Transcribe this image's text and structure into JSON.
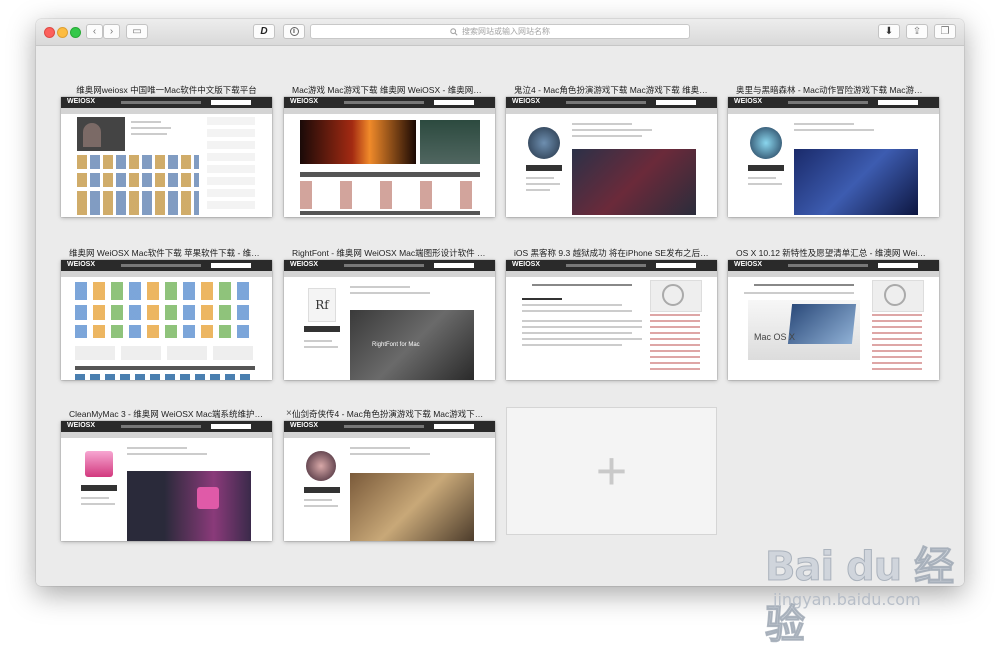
{
  "toolbar": {
    "back_glyph": "‹",
    "forward_glyph": "›",
    "sidebar_glyph": "▭",
    "ext_glyph": "D",
    "info_glyph": "i",
    "address_placeholder": "搜索网站或输入网站名称",
    "download_glyph": "⬇",
    "share_glyph": "⇪",
    "tabs_glyph": "❐"
  },
  "tabs": [
    {
      "title": "维奥网weiosx 中国唯一Mac软件中文版下载平台",
      "variant": "grid"
    },
    {
      "title": "Mac游戏 Mac游戏下载 维奥网 WeiOSX - 维奥网weio...",
      "variant": "banner"
    },
    {
      "title": "鬼泣4 - Mac角色扮演游戏下载 Mac游戏下载 维奥网...",
      "variant": "detail"
    },
    {
      "title": "奥里与黑暗森林 - Mac动作冒险游戏下载 Mac游戏下...",
      "variant": "detail"
    },
    {
      "title": "维奥网 WeiOSX Mac软件下载 苹果软件下载 - 维奥网...",
      "variant": "icons"
    },
    {
      "title": "RightFont - 维奥网 WeiOSX Mac端图形设计软件 Ma...",
      "variant": "detail"
    },
    {
      "title": "iOS 黑客称 9.3 越狱成功 将在iPhone SE发布之后公...",
      "variant": "article"
    },
    {
      "title": "OS X 10.12 新特性及愿望清单汇总 - 维澳网 WeiOSX...",
      "variant": "article"
    },
    {
      "title": "CleanMyMac 3 - 维奥网 WeiOSX Mac端系统维护软...",
      "variant": "detail"
    },
    {
      "title": "仙剑奇侠传4 - Mac角色扮演游戏下载 Mac游戏下载...",
      "variant": "detail",
      "hovered": true
    }
  ],
  "thumb_text": {
    "logo": "WEIOSX",
    "download_btn": "立即下载",
    "rightfont_heading": "RightFont for Mac",
    "macosx": "Mac OS X"
  },
  "new_tab": {
    "glyph": "+"
  },
  "watermark": {
    "brand": "Bai du 经验",
    "url": "jingyan.baidu.com"
  },
  "colors": {
    "nav_dark": "#2a2a2a",
    "accent_red": "#fc605c"
  }
}
